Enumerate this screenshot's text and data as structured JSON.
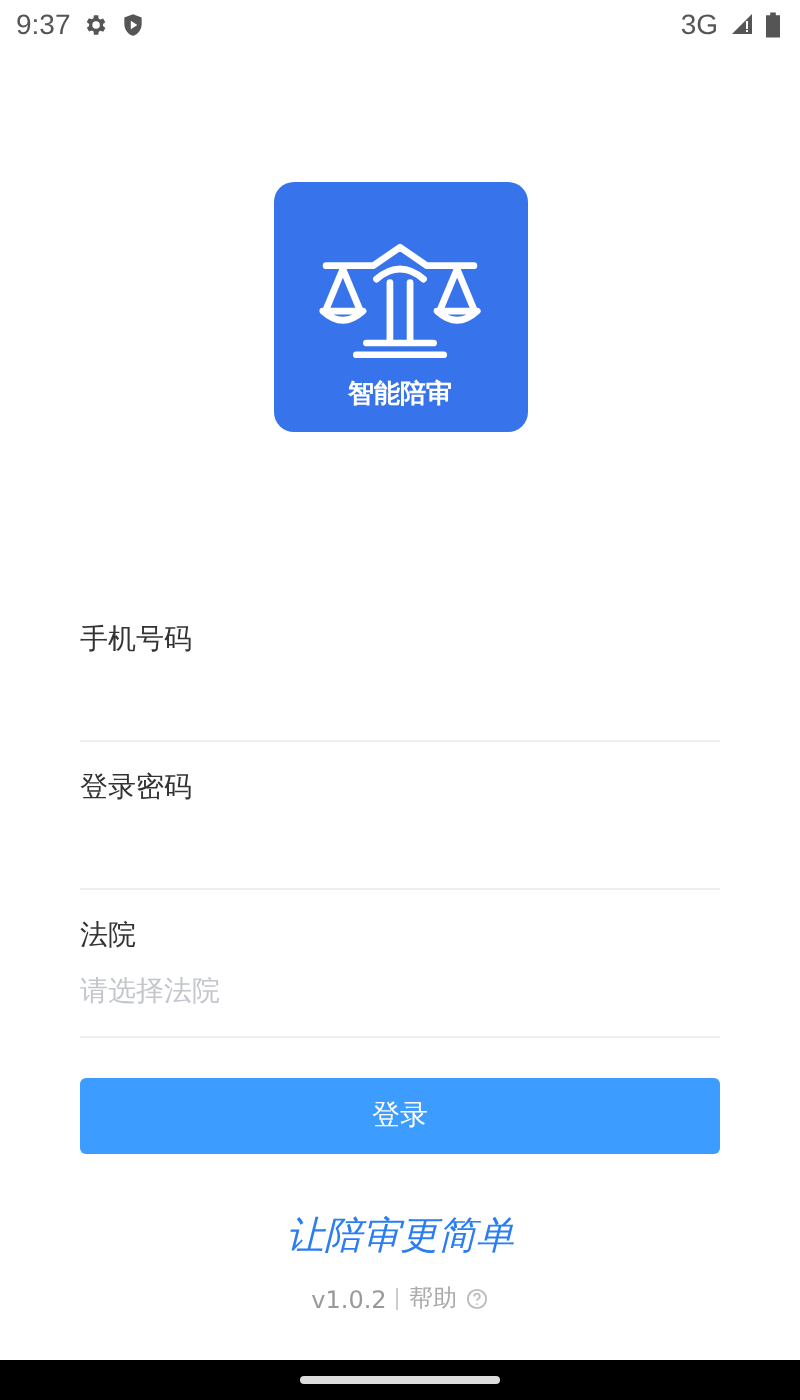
{
  "status_bar": {
    "time": "9:37",
    "network": "3G"
  },
  "logo": {
    "title": "智能陪审"
  },
  "fields": [
    {
      "label": "手机号码"
    },
    {
      "label": "登录密码"
    },
    {
      "label": "法院",
      "placeholder": "请选择法院"
    }
  ],
  "login_button": "登录",
  "slogan": "让陪审更简单",
  "footer": {
    "version": "v1.0.2",
    "help": "帮助"
  }
}
